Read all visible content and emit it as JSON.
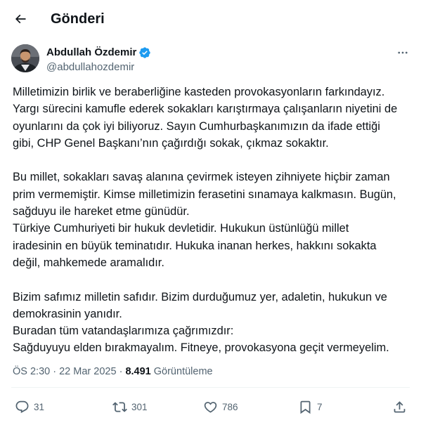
{
  "header": {
    "title": "Gönderi"
  },
  "author": {
    "name": "Abdullah Özdemir",
    "handle": "@abdullahozdemir"
  },
  "tweet": {
    "lines": [
      "Milletimizin birlik ve beraberliğine kasteden provokasyonların farkındayız.",
      "Yargı sürecini kamufle ederek sokakları karıştırmaya çalışanların niyetini de",
      "oyunlarını da çok iyi biliyoruz. Sayın Cumhurbaşkanımızın da ifade ettiği",
      "gibi, CHP Genel Başkanı’nın çağırdığı sokak, çıkmaz sokaktır.",
      "",
      "Bu millet, sokakları savaş alanına çevirmek isteyen zihniyete hiçbir zaman",
      "prim vermemiştir. Kimse milletimizin ferasetini sınamaya kalkmasın. Bugün,",
      "sağduyu ile hareket etme günüdür.",
      "Türkiye Cumhuriyeti bir hukuk devletidir. Hukukun üstünlüğü millet",
      "iradesinin en büyük teminatıdır. Hukuka inanan herkes, hakkını sokakta",
      "değil, mahkemede aramalıdır.",
      "",
      "Bizim safımız milletin safıdır. Bizim durduğumuz yer, adaletin, hukukun ve",
      "demokrasinin yanıdır.",
      "Buradan tüm vatandaşlarımıza çağrımızdır:",
      "Sağduyuyu elden bırakmayalım. Fitneye, provokasyona geçit vermeyelim."
    ]
  },
  "meta": {
    "time": "ÖS 2:30",
    "separator": "·",
    "date": "22 Mar 2025",
    "views_count": "8.491",
    "views_label": "Görüntüleme"
  },
  "actions": {
    "replies": "31",
    "reposts": "301",
    "likes": "786",
    "bookmarks": "7"
  },
  "colors": {
    "text": "#0f1419",
    "secondary": "#536471",
    "verified": "#1d9bf0",
    "divider": "#eff3f4"
  }
}
